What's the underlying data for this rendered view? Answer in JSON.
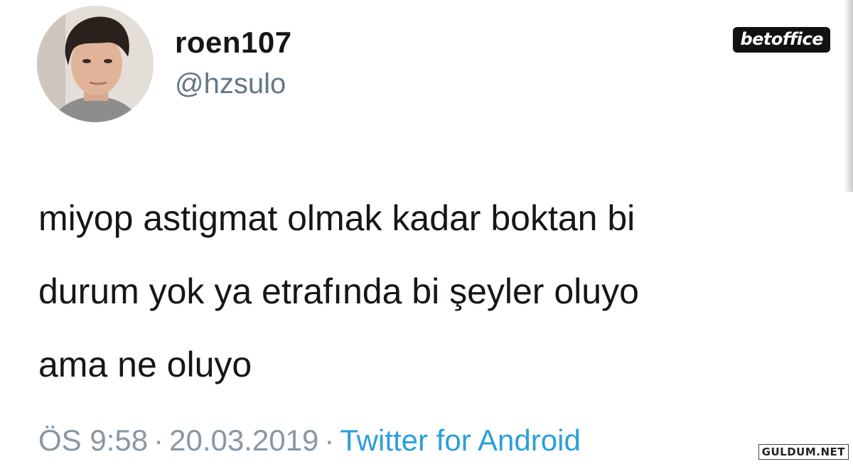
{
  "user": {
    "display_name": "roen107",
    "handle": "@hzsulo",
    "avatar_icon": "profile-photo-icon"
  },
  "tweet": {
    "lines": [
      "miyop astigmat olmak kadar boktan bi",
      "durum yok ya etrafında bi şeyler oluyo",
      "ama ne oluyo"
    ]
  },
  "meta": {
    "time": "ÖS 9:58",
    "separator": "·",
    "date": "20.03.2019",
    "source": "Twitter for Android"
  },
  "watermarks": {
    "top": "betoffice",
    "bottom": "GULDUM.NET"
  },
  "colors": {
    "handle": "#657786",
    "meta": "#8a97a3",
    "source_link": "#2a9fd8"
  }
}
